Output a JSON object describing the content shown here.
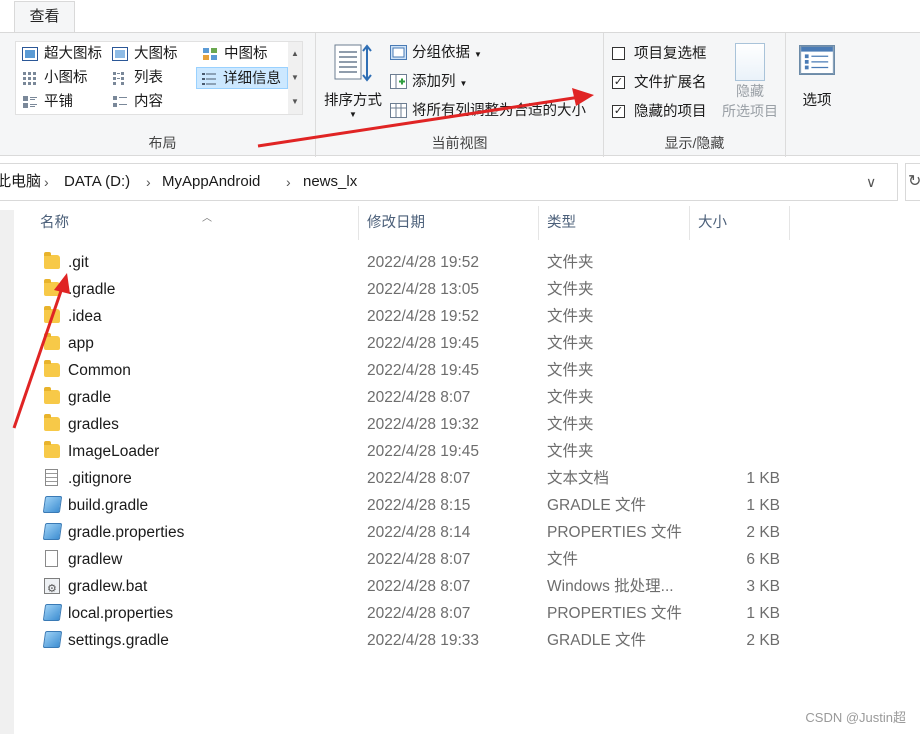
{
  "ribbon": {
    "tab": "查看",
    "layout": {
      "label": "布局",
      "items": [
        "超大图标",
        "大图标",
        "中图标",
        "小图标",
        "列表",
        "详细信息",
        "平铺",
        "内容"
      ],
      "selected": "详细信息"
    },
    "current_view": {
      "label": "当前视图",
      "sort_by": "排序方式",
      "group_by": "分组依据",
      "add_columns": "添加列",
      "size_all_columns": "将所有列调整为合适的大小"
    },
    "show_hide": {
      "label": "显示/隐藏",
      "item_checkboxes": {
        "label": "项目复选框",
        "checked": false
      },
      "file_extensions": {
        "label": "文件扩展名",
        "checked": true
      },
      "hidden_items": {
        "label": "隐藏的项目",
        "checked": true
      },
      "hide_selected_line1": "隐藏",
      "hide_selected_line2": "所选项目"
    },
    "options": "选项"
  },
  "address": {
    "crumbs": [
      "此电脑",
      "DATA (D:)",
      "MyAppAndroid",
      "news_lx"
    ]
  },
  "columns": {
    "name": "名称",
    "date": "修改日期",
    "type": "类型",
    "size": "大小"
  },
  "files": [
    {
      "name": ".git",
      "date": "2022/4/28 19:52",
      "type": "文件夹",
      "size": "",
      "icon": "folder-icon"
    },
    {
      "name": ".gradle",
      "date": "2022/4/28 13:05",
      "type": "文件夹",
      "size": "",
      "icon": "folder-icon"
    },
    {
      "name": ".idea",
      "date": "2022/4/28 19:52",
      "type": "文件夹",
      "size": "",
      "icon": "folder-icon"
    },
    {
      "name": "app",
      "date": "2022/4/28 19:45",
      "type": "文件夹",
      "size": "",
      "icon": "folder-icon"
    },
    {
      "name": "Common",
      "date": "2022/4/28 19:45",
      "type": "文件夹",
      "size": "",
      "icon": "folder-icon"
    },
    {
      "name": "gradle",
      "date": "2022/4/28 8:07",
      "type": "文件夹",
      "size": "",
      "icon": "folder-icon"
    },
    {
      "name": "gradles",
      "date": "2022/4/28 19:32",
      "type": "文件夹",
      "size": "",
      "icon": "folder-icon"
    },
    {
      "name": "ImageLoader",
      "date": "2022/4/28 19:45",
      "type": "文件夹",
      "size": "",
      "icon": "folder-icon"
    },
    {
      "name": ".gitignore",
      "date": "2022/4/28 8:07",
      "type": "文本文档",
      "size": "1 KB",
      "icon": "text-file-icon"
    },
    {
      "name": "build.gradle",
      "date": "2022/4/28 8:15",
      "type": "GRADLE 文件",
      "size": "1 KB",
      "icon": "gradle-file-icon"
    },
    {
      "name": "gradle.properties",
      "date": "2022/4/28 8:14",
      "type": "PROPERTIES 文件",
      "size": "2 KB",
      "icon": "gradle-file-icon"
    },
    {
      "name": "gradlew",
      "date": "2022/4/28 8:07",
      "type": "文件",
      "size": "6 KB",
      "icon": "file-icon"
    },
    {
      "name": "gradlew.bat",
      "date": "2022/4/28 8:07",
      "type": "Windows 批处理...",
      "size": "3 KB",
      "icon": "batch-file-icon"
    },
    {
      "name": "local.properties",
      "date": "2022/4/28 8:07",
      "type": "PROPERTIES 文件",
      "size": "1 KB",
      "icon": "gradle-file-icon"
    },
    {
      "name": "settings.gradle",
      "date": "2022/4/28 19:33",
      "type": "GRADLE 文件",
      "size": "2 KB",
      "icon": "gradle-file-icon"
    }
  ],
  "watermark": "CSDN @Justin超",
  "colors": {
    "selection": "#cce8ff",
    "annotation_arrow": "#e02424",
    "folder": "#f7c948"
  }
}
